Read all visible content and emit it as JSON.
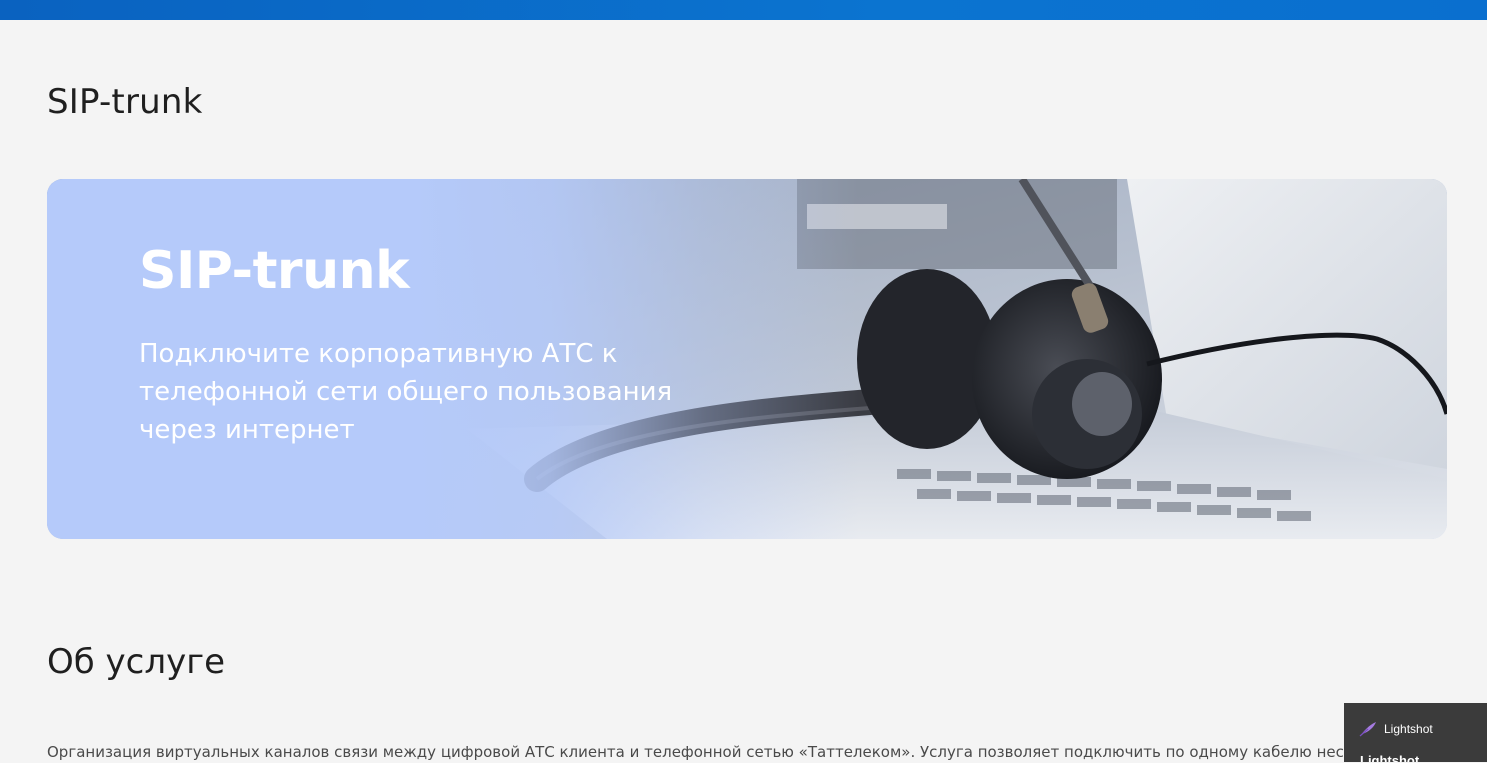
{
  "page": {
    "title": "SIP-trunk"
  },
  "banner": {
    "title": "SIP-trunk",
    "subtitle": "Подключите корпоративную АТС к телефонной сети общего пользования через интернет",
    "image": "headset-on-laptop-photo"
  },
  "about": {
    "heading": "Об услуге",
    "text": "Организация виртуальных каналов связи между цифровой АТС клиента и телефонной сетью «Таттелеком». Услуга позволяет подключить по одному кабелю нескольк"
  },
  "lightshot": {
    "name": "Lightshot",
    "name_partial": "Lightshot",
    "icon": "feather-icon"
  },
  "colors": {
    "top_bar": "#0b74d0",
    "banner_bg": "#b6cbf8",
    "page_bg": "#f4f4f4"
  }
}
